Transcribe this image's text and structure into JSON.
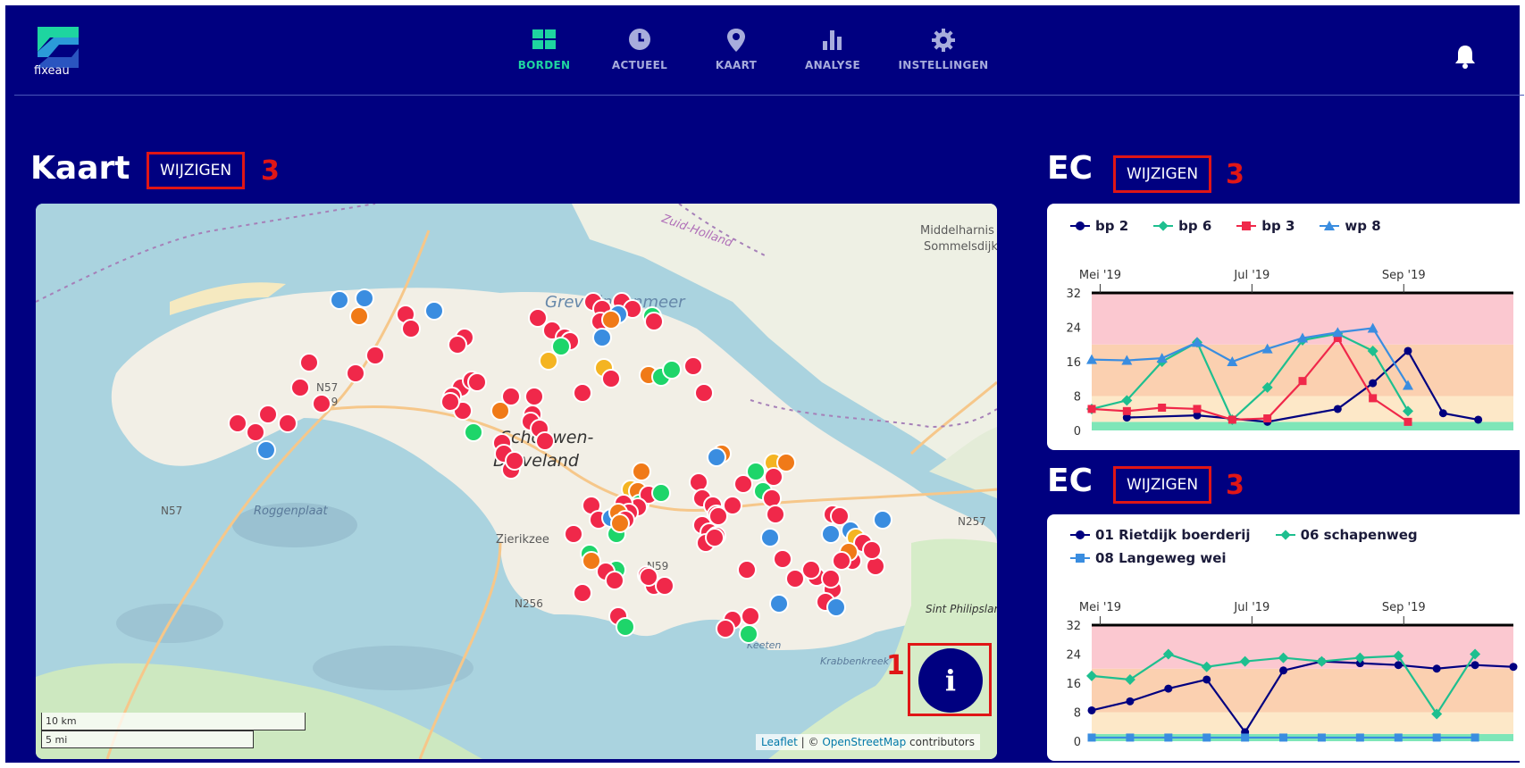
{
  "app": {
    "logo_text": "fixeau",
    "nav": [
      {
        "label": "BORDEN",
        "icon": "dashboard-icon",
        "active": true
      },
      {
        "label": "ACTUEEL",
        "icon": "clock-icon",
        "active": false
      },
      {
        "label": "KAART",
        "icon": "map-pin-icon",
        "active": false
      },
      {
        "label": "ANALYSE",
        "icon": "bar-chart-icon",
        "active": false
      },
      {
        "label": "INSTELLINGEN",
        "icon": "gear-icon",
        "active": false
      }
    ],
    "notification_icon": "bell-icon"
  },
  "map_section": {
    "title": "Kaart",
    "edit_label": "WIJZIGEN",
    "annotation": "3",
    "info_label": "i",
    "info_annotation": "1",
    "scale_km": "10 km",
    "scale_mi": "5 mi",
    "attribution_leaflet": "Leaflet",
    "attribution_sep": " | © ",
    "attribution_osm": "OpenStreetMap",
    "attribution_rest": " contributors",
    "place_labels": [
      "Zuid-Holland",
      "Grevelingenmeer",
      "Middelharnis",
      "Sommelsdijk",
      "N57",
      "N59",
      "Schouwen-",
      "Duiveland",
      "Roggenplaat",
      "N57",
      "N257",
      "Zierikzee",
      "N59",
      "N256",
      "Sint Philipsland",
      "Keeten",
      "Krabbenkreek"
    ]
  },
  "chart_sections": [
    {
      "title": "EC",
      "edit_label": "WIJZIGEN",
      "annotation": "3"
    },
    {
      "title": "EC",
      "edit_label": "WIJZIGEN",
      "annotation": "3"
    }
  ],
  "chart_data": [
    {
      "type": "line",
      "title": "EC",
      "x_tick_labels": [
        "Mei '19",
        "Jul '19",
        "Sep '19"
      ],
      "y_ticks": [
        0,
        8,
        16,
        24,
        32
      ],
      "ylim": [
        0,
        32
      ],
      "bands": [
        {
          "from": 0,
          "to": 2,
          "color": "#7ee6b8"
        },
        {
          "from": 2,
          "to": 8,
          "color": "#fde8c8"
        },
        {
          "from": 8,
          "to": 20,
          "color": "#fbd0b0"
        },
        {
          "from": 20,
          "to": 32,
          "color": "#fbc8d0"
        }
      ],
      "threshold_line": 32,
      "x": [
        0,
        1,
        2,
        3,
        4,
        5,
        6,
        7,
        8,
        9,
        10,
        11,
        12
      ],
      "series": [
        {
          "name": "bp 2",
          "color": "#000080",
          "marker": "circle",
          "values": [
            null,
            3,
            null,
            3.5,
            null,
            2,
            null,
            5,
            11,
            18.5,
            4,
            2.5,
            null
          ]
        },
        {
          "name": "bp 6",
          "color": "#1ebf8f",
          "marker": "diamond",
          "values": [
            5,
            7,
            16,
            20.5,
            2.5,
            10,
            21,
            22.5,
            18.5,
            4.5,
            null,
            null,
            null
          ]
        },
        {
          "name": "bp 3",
          "color": "#f0284a",
          "marker": "square",
          "values": [
            5,
            4.5,
            5.3,
            5,
            2.5,
            2.8,
            11.5,
            21.5,
            7.5,
            2,
            null,
            null,
            null
          ]
        },
        {
          "name": "wp 8",
          "color": "#3a8de0",
          "marker": "triangle",
          "values": [
            16.5,
            16.3,
            16.8,
            20.5,
            16,
            19,
            21.5,
            22.8,
            23.8,
            10.5,
            null,
            null,
            null
          ]
        }
      ]
    },
    {
      "type": "line",
      "title": "EC",
      "x_tick_labels": [
        "Mei '19",
        "Jul '19",
        "Sep '19"
      ],
      "y_ticks": [
        0,
        8,
        16,
        24,
        32
      ],
      "ylim": [
        0,
        32
      ],
      "bands": [
        {
          "from": 0,
          "to": 2,
          "color": "#7ee6b8"
        },
        {
          "from": 2,
          "to": 8,
          "color": "#fde8c8"
        },
        {
          "from": 8,
          "to": 20,
          "color": "#fbd0b0"
        },
        {
          "from": 20,
          "to": 32,
          "color": "#fbc8d0"
        }
      ],
      "threshold_line": 32,
      "series": [
        {
          "name": "01 Rietdijk boerderij",
          "color": "#000080",
          "marker": "circle",
          "values": [
            8.5,
            11,
            14.5,
            17,
            2.5,
            19.5,
            22,
            21.5,
            21,
            20,
            21,
            20.5
          ]
        },
        {
          "name": "06 schapenweg",
          "color": "#1ebf8f",
          "marker": "diamond",
          "values": [
            18,
            17,
            24,
            20.5,
            22,
            23,
            22,
            23,
            23.5,
            7.5,
            24
          ]
        },
        {
          "name": "08 Langeweg wei",
          "color": "#3a8de0",
          "marker": "square",
          "values": [
            1,
            1,
            1,
            1,
            1,
            1,
            1,
            1,
            1,
            1,
            1
          ]
        }
      ]
    }
  ]
}
